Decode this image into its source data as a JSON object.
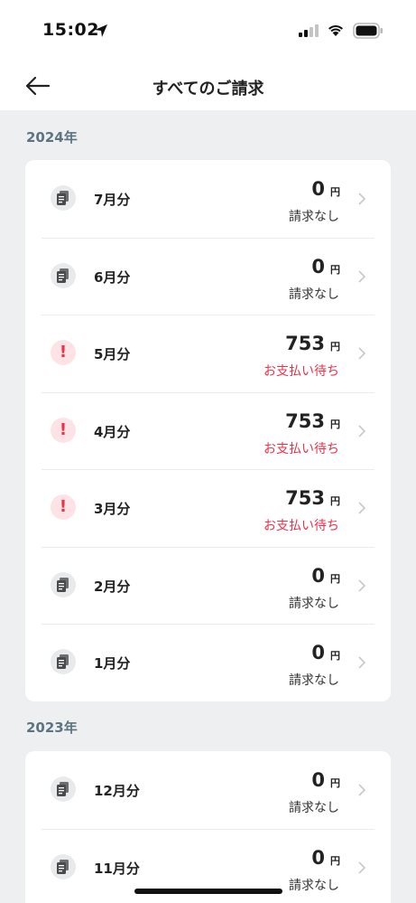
{
  "status_bar": {
    "time": "15:02"
  },
  "nav": {
    "title": "すべてのご請求"
  },
  "sections": [
    {
      "year": "2024年",
      "rows": [
        {
          "month": "7月分",
          "amount": "0",
          "unit": "円",
          "status": "請求なし",
          "state": "none"
        },
        {
          "month": "6月分",
          "amount": "0",
          "unit": "円",
          "status": "請求なし",
          "state": "none"
        },
        {
          "month": "5月分",
          "amount": "753",
          "unit": "円",
          "status": "お支払い待ち",
          "state": "pending"
        },
        {
          "month": "4月分",
          "amount": "753",
          "unit": "円",
          "status": "お支払い待ち",
          "state": "pending"
        },
        {
          "month": "3月分",
          "amount": "753",
          "unit": "円",
          "status": "お支払い待ち",
          "state": "pending"
        },
        {
          "month": "2月分",
          "amount": "0",
          "unit": "円",
          "status": "請求なし",
          "state": "none"
        },
        {
          "month": "1月分",
          "amount": "0",
          "unit": "円",
          "status": "請求なし",
          "state": "none"
        }
      ]
    },
    {
      "year": "2023年",
      "rows": [
        {
          "month": "12月分",
          "amount": "0",
          "unit": "円",
          "status": "請求なし",
          "state": "none"
        },
        {
          "month": "11月分",
          "amount": "0",
          "unit": "円",
          "status": "請求なし",
          "state": "none"
        }
      ]
    }
  ],
  "colors": {
    "pending": "#e8334a",
    "year_label": "#5b7482",
    "background": "#eeeff1"
  },
  "icons": {
    "none": "document-icon",
    "pending": "alert-icon"
  }
}
